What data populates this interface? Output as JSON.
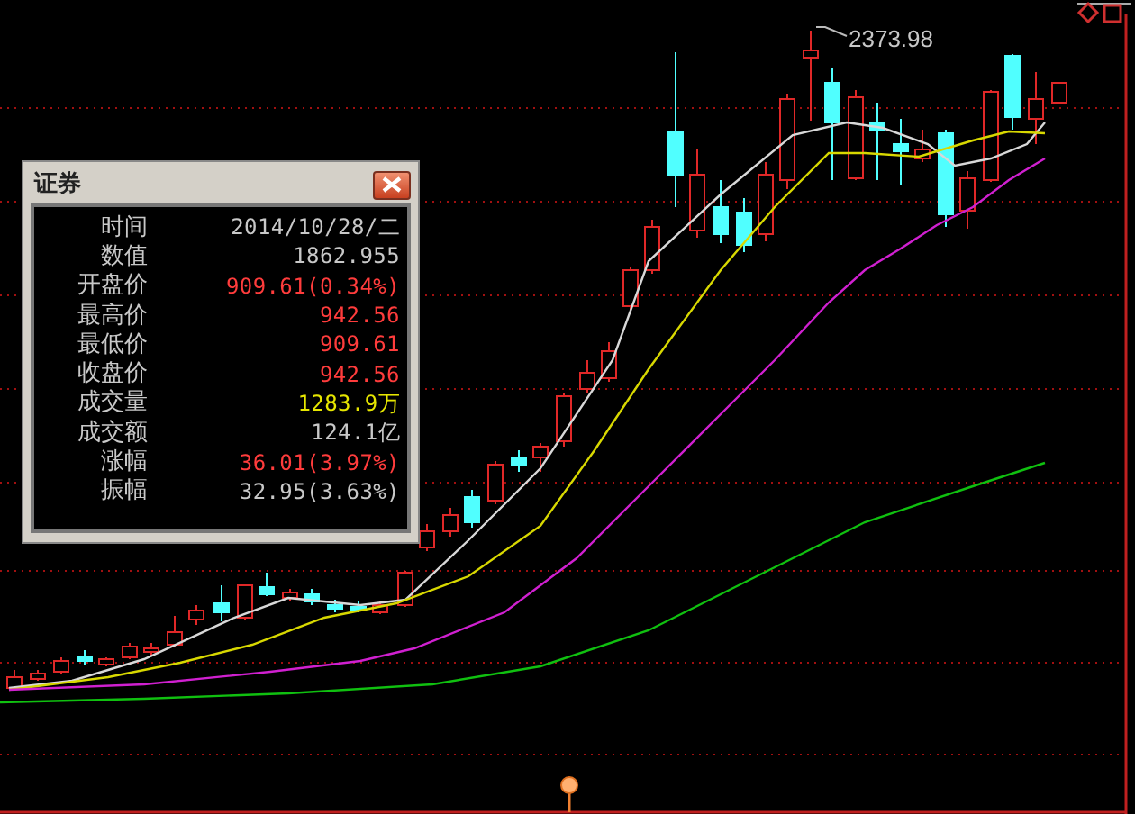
{
  "chart": {
    "peak_label": "2373.98"
  },
  "info_panel": {
    "title": "证券",
    "rows": [
      {
        "label": "时间",
        "value": "2014/10/28/二",
        "color": "#c8c8c8"
      },
      {
        "label": "数值",
        "value": "1862.955",
        "color": "#c8c8c8"
      },
      {
        "label": "开盘价",
        "value": "909.61(0.34%)",
        "color": "#ff3c3c"
      },
      {
        "label": "最高价",
        "value": "942.56",
        "color": "#ff3c3c"
      },
      {
        "label": "最低价",
        "value": "909.61",
        "color": "#ff3c3c"
      },
      {
        "label": "收盘价",
        "value": "942.56",
        "color": "#ff3c3c"
      },
      {
        "label": "成交量",
        "value": "1283.9万",
        "color": "#e6e600"
      },
      {
        "label": "成交额",
        "value": "124.1亿",
        "color": "#c8c8c8"
      },
      {
        "label": "涨幅",
        "value": "36.01(3.97%)",
        "color": "#ff3c3c"
      },
      {
        "label": "振幅",
        "value": "32.95(3.63%)",
        "color": "#c8c8c8"
      }
    ]
  }
}
